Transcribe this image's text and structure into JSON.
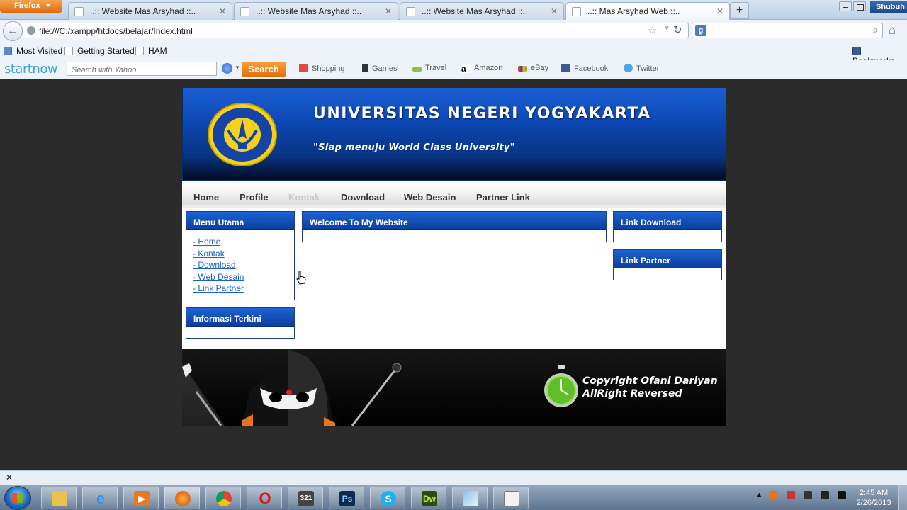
{
  "browser": {
    "app_button": "Firefox",
    "tabs": [
      {
        "title": "..:: Website Mas Arsyhad ::.."
      },
      {
        "title": "..:: Website Mas Arsyhad ::.."
      },
      {
        "title": "..:: Website Mas Arsyhad ::.."
      },
      {
        "title": "..:: Mas Arsyhad Web ::.."
      }
    ],
    "user": "Shubuh",
    "url": "file:///C:/xampp/htdocs/belajar/Index.html",
    "bookmarks": [
      "Most Visited",
      "Getting Started",
      "HAM"
    ],
    "bookmarks_menu": "Bookmarks"
  },
  "startnow": {
    "logo": "startnow",
    "search_placeholder": "Search with Yahoo",
    "search_button": "Search",
    "links": [
      "Shopping",
      "Games",
      "Travel",
      "Amazon",
      "eBay",
      "Facebook",
      "Twitter"
    ]
  },
  "site": {
    "title": "UNIVERSITAS NEGERI YOGYAKARTA",
    "tagline": "\"Siap menuju World Class University\"",
    "nav": [
      "Home",
      "Profile",
      "Kontak",
      "Download",
      "Web Desain",
      "Partner Link"
    ],
    "menu_utama": {
      "heading": "Menu Utama",
      "links": [
        "- Home",
        "- Kontak",
        "- Download",
        "- Web Desain",
        "- Link Partner"
      ]
    },
    "informasi_heading": "Informasi Terkini",
    "welcome_heading": "Welcome To My Website",
    "link_download_heading": "Link Download",
    "link_partner_heading": "Link Partner",
    "footer": {
      "line1": "Copyright Ofani Dariyan",
      "line2": "AllRight Reversed"
    }
  },
  "taskbar": {
    "time": "2:45 AM",
    "date": "2/26/2013"
  }
}
